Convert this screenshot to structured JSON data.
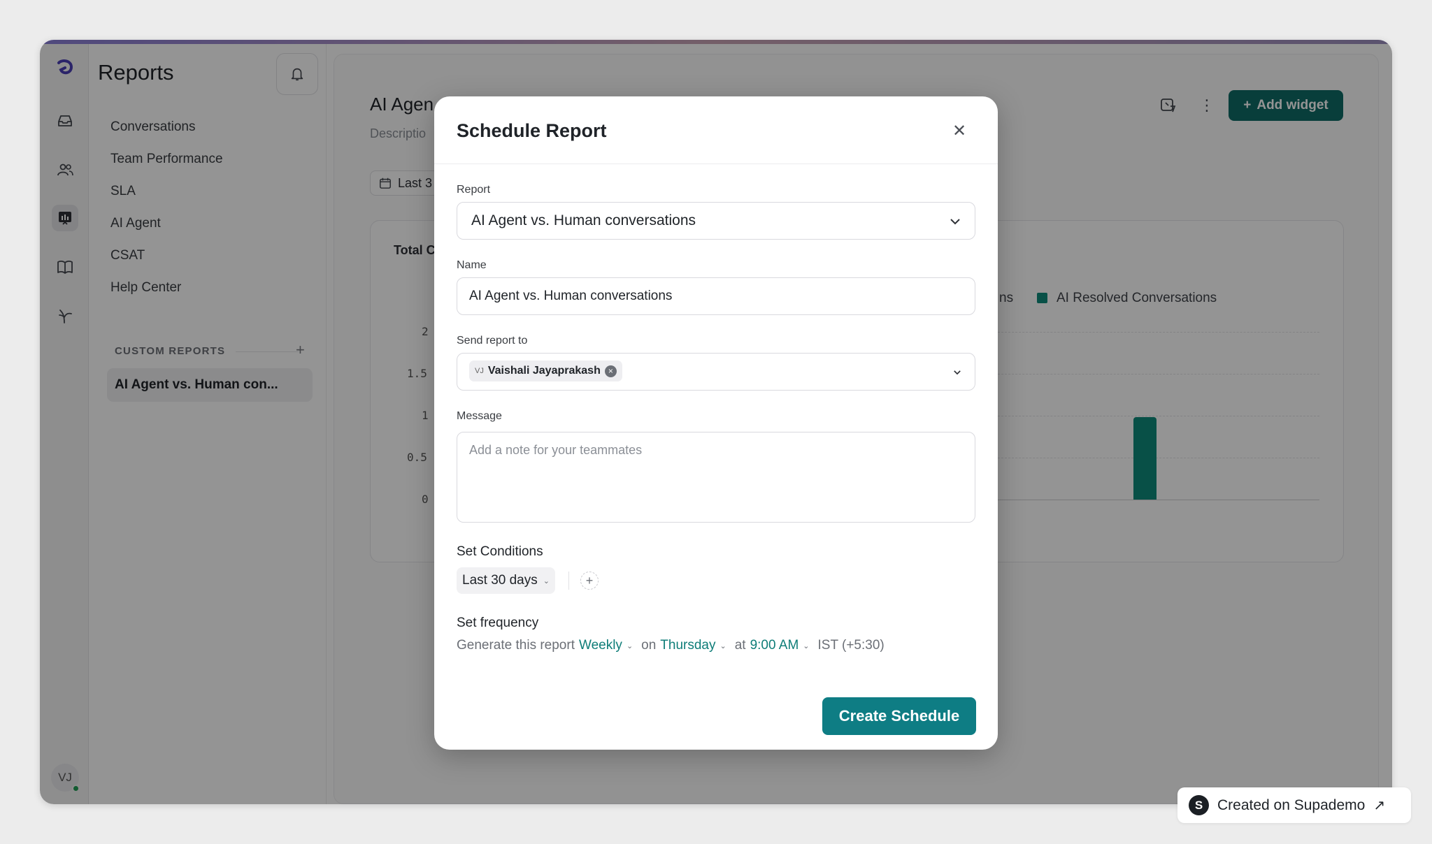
{
  "sidebar": {
    "title": "Reports",
    "items": [
      {
        "label": "Conversations"
      },
      {
        "label": "Team Performance"
      },
      {
        "label": "SLA"
      },
      {
        "label": "AI Agent"
      },
      {
        "label": "CSAT"
      },
      {
        "label": "Help Center"
      }
    ],
    "custom_reports_heading": "CUSTOM REPORTS",
    "custom_reports": [
      {
        "label": "AI Agent vs. Human con..."
      }
    ]
  },
  "user": {
    "initials": "VJ"
  },
  "page": {
    "title": "AI Agen",
    "description": "Descriptio",
    "date_filter": "Last 3",
    "add_widget_label": "Add widget",
    "chart_title": "Total C"
  },
  "chart_data": {
    "type": "bar",
    "title": "Total C",
    "y_ticks": [
      "2",
      "1.5",
      "1",
      "0.5",
      "0"
    ],
    "ylim": [
      0,
      2
    ],
    "legend_partial": "ns",
    "series": [
      {
        "name": "AI Resolved Conversations",
        "values": [
          1
        ],
        "color": "#0e8a7a"
      }
    ]
  },
  "modal": {
    "title": "Schedule Report",
    "report_label": "Report",
    "report_value": "AI Agent vs. Human conversations",
    "name_label": "Name",
    "name_value": "AI Agent vs. Human conversations",
    "send_to_label": "Send report to",
    "recipient": {
      "initials": "VJ",
      "name": "Vaishali Jayaprakash"
    },
    "message_label": "Message",
    "message_placeholder": "Add a note for your teammates",
    "conditions_heading": "Set Conditions",
    "condition_value": "Last 30 days",
    "frequency_heading": "Set frequency",
    "frequency": {
      "prefix": "Generate this report",
      "interval": "Weekly",
      "on_label": "on",
      "day": "Thursday",
      "at_label": "at",
      "time": "9:00 AM",
      "timezone": "IST (+5:30)"
    },
    "submit_label": "Create Schedule"
  },
  "badge": {
    "logo_letter": "S",
    "text": "Created on Supademo",
    "arrow": "↗"
  },
  "colors": {
    "accent": "#0e7d84",
    "chart_bar": "#0e8a7a"
  }
}
